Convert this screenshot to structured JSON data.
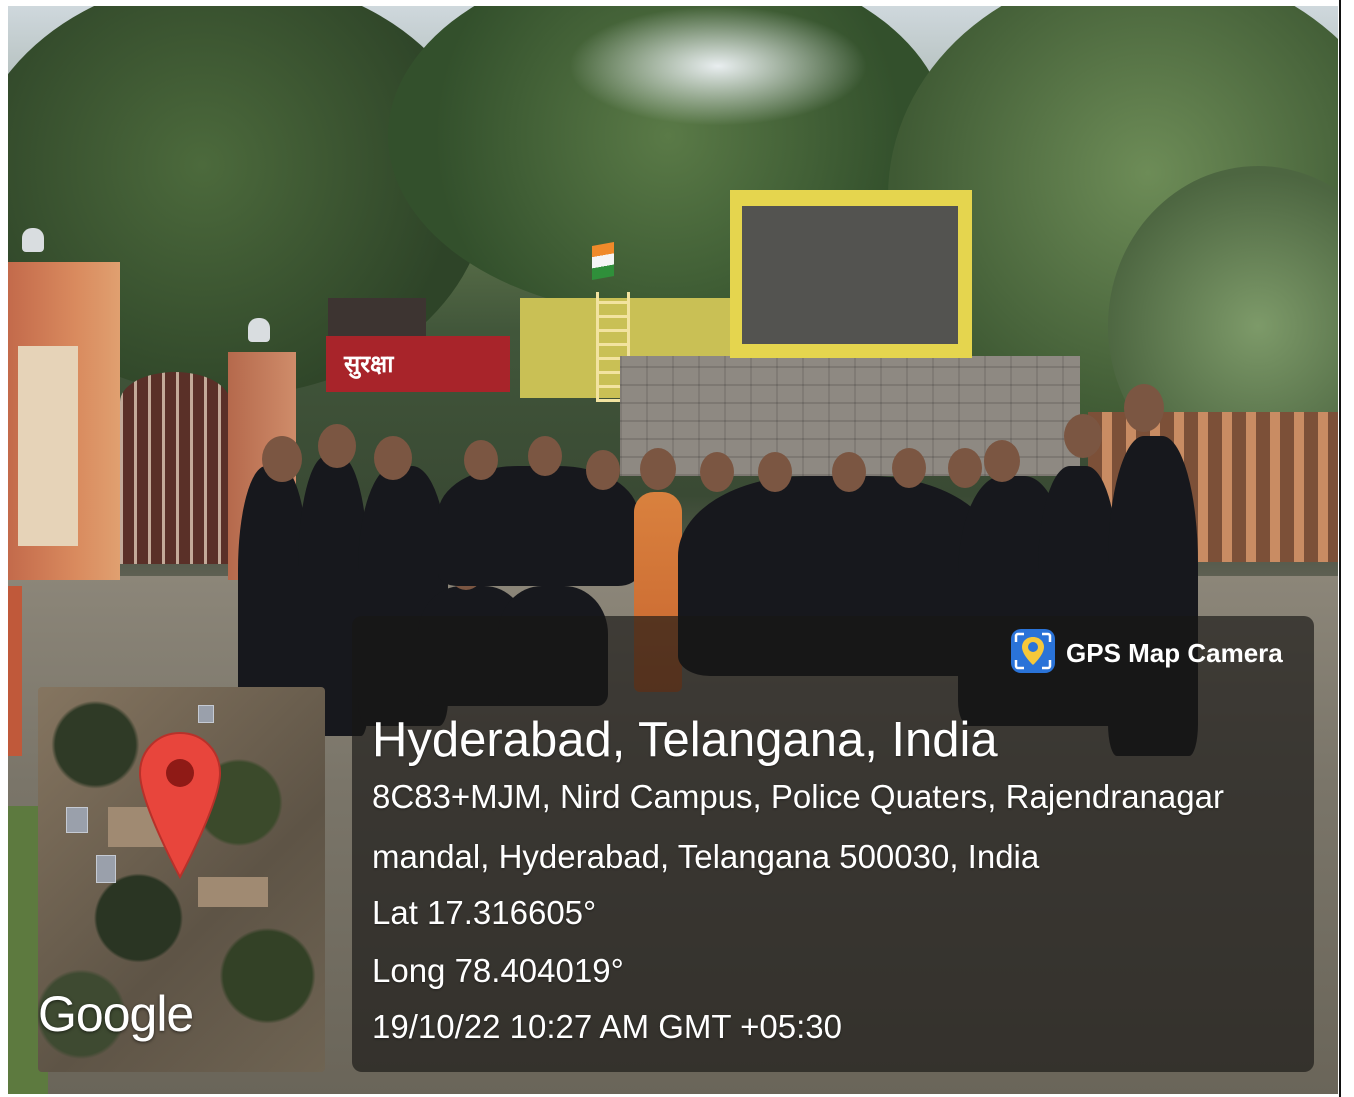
{
  "scene": {
    "signboard_text": "सुरक्षा"
  },
  "overlay": {
    "app_badge": "GPS Map Camera",
    "place_title": "Hyderabad, Telangana, India",
    "address_line_1": "8C83+MJM, Nird Campus, Police Quaters, Rajendranagar",
    "address_line_2": "mandal, Hyderabad, Telangana 500030, India",
    "latitude": "Lat 17.316605°",
    "longitude": "Long 78.404019°",
    "timestamp": "19/10/22 10:27 AM GMT +05:30",
    "map_logo": "Google"
  },
  "colors": {
    "pin_red": "#e8453c",
    "panel_background": "rgba(25,23,21,0.66)",
    "badge_blue": "#2a73d8",
    "badge_yellow": "#f6c83a"
  },
  "icons": [
    "map-pin-icon",
    "gps-camera-app-icon"
  ]
}
